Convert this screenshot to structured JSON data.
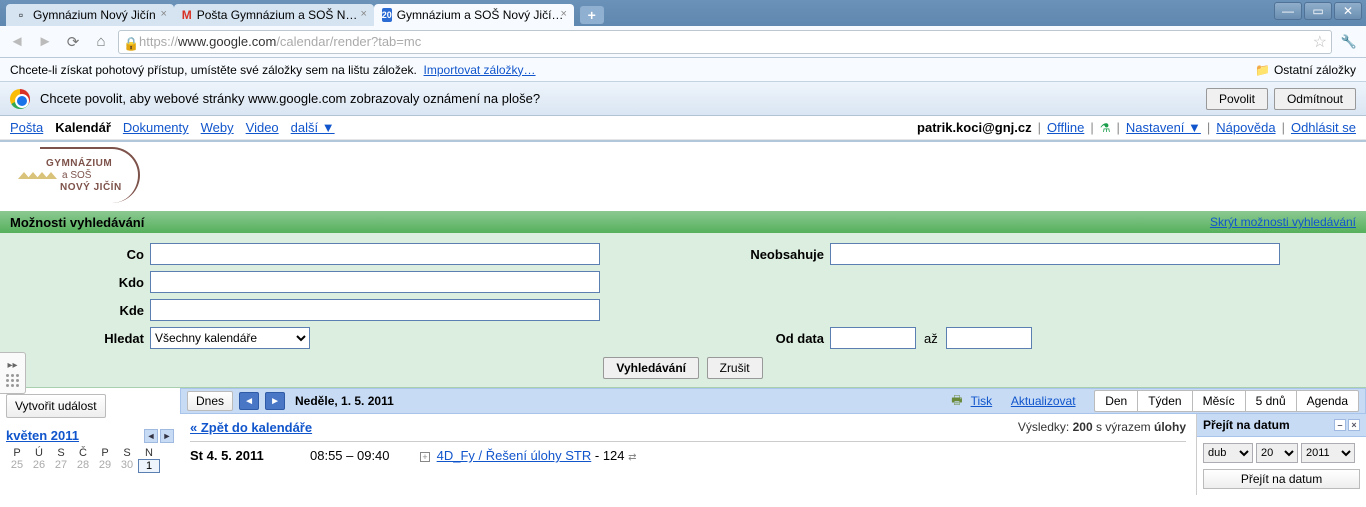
{
  "browser": {
    "tabs": [
      {
        "title": "Gymnázium Nový Jičín",
        "icon": "page"
      },
      {
        "title": "Pošta Gymnázium a SOŠ N…",
        "icon": "gmail"
      },
      {
        "title": "Gymnázium a SOŠ Nový Jičí…",
        "icon": "cal",
        "badge": "20",
        "active": true
      }
    ],
    "url_scheme": "https://",
    "url_host": "www.google.com",
    "url_path": "/calendar/render?tab=mc",
    "bookmark_hint": "Chcete-li získat pohotový přístup, umístěte své záložky sem na lištu záložek.",
    "import_link": "Importovat záložky…",
    "other_bookmarks": "Ostatní záložky",
    "infobar_text": "Chcete povolit, aby webové stránky www.google.com zobrazovaly oznámení na ploše?",
    "allow": "Povolit",
    "deny": "Odmítnout"
  },
  "gbar": {
    "links": [
      "Pošta",
      "Kalendář",
      "Dokumenty",
      "Weby",
      "Video",
      "další ▼"
    ],
    "active_index": 1,
    "email": "patrik.koci@gnj.cz",
    "offline": "Offline",
    "settings": "Nastavení ▼",
    "help": "Nápověda",
    "signout": "Odhlásit se"
  },
  "logo": {
    "l1": "GYMNÁZIUM",
    "l2": "a SOŠ",
    "l3": "NOVÝ JIČÍN"
  },
  "search": {
    "title": "Možnosti vyhledávání",
    "hide": "Skrýt možnosti vyhledávání",
    "labels": {
      "what": "Co",
      "who": "Kdo",
      "where": "Kde",
      "not": "Neobsahuje",
      "searchin": "Hledat",
      "from": "Od data",
      "to": "až"
    },
    "select_value": "Všechny kalendáře",
    "btn_search": "Vyhledávání",
    "btn_cancel": "Zrušit"
  },
  "left": {
    "create": "Vytvořit událost",
    "month": "květen 2011",
    "dow": [
      "P",
      "Ú",
      "S",
      "Č",
      "P",
      "S",
      "N"
    ],
    "days": [
      "25",
      "26",
      "27",
      "28",
      "29",
      "30",
      "1"
    ]
  },
  "datebar": {
    "today": "Dnes",
    "date": "Neděle, 1. 5. 2011",
    "print": "Tisk",
    "refresh": "Aktualizovat",
    "views": [
      "Den",
      "Týden",
      "Měsíc",
      "5 dnů",
      "Agenda"
    ]
  },
  "results": {
    "back": "« Zpět do kalendáře",
    "count_label": "Výsledky:",
    "count": "200",
    "with_text": "s výrazem",
    "term": "úlohy",
    "event": {
      "date": "St 4. 5. 2011",
      "time": "08:55 – 09:40",
      "title": "4D_Fy / Řešení úlohy STR",
      "suffix": "- 124",
      "recurring": "⇄"
    }
  },
  "sidepanel": {
    "title": "Přejít na datum",
    "month_options": [
      "dub"
    ],
    "day_options": [
      "20"
    ],
    "year_options": [
      "2011"
    ],
    "button": "Přejít na datum"
  }
}
